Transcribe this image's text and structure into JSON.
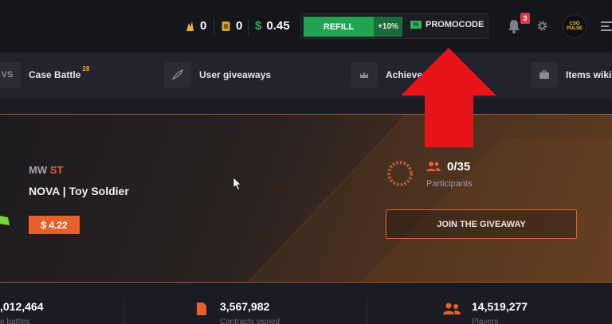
{
  "topbar": {
    "currency_horns": "0",
    "currency_coins": "0",
    "balance_symbol": "$",
    "balance_value": "0.45",
    "refill_label": "REFILL",
    "refill_bonus": "+10%",
    "promo_label": "PROMOCODE",
    "notification_count": "3",
    "avatar_text": "CSG PULSE"
  },
  "nav": {
    "items": [
      {
        "label": "Case Battle",
        "sup": "28",
        "icon": "vs-icon",
        "icon_text": "VS"
      },
      {
        "label": "User giveaways",
        "icon": "feather-icon"
      },
      {
        "label": "Achiever",
        "icon": "crown-icon"
      },
      {
        "label": "Items wiki",
        "icon": "briefcase-icon"
      }
    ]
  },
  "giveaway": {
    "quality_prefix": "MW",
    "quality_st": "ST",
    "item_name": "NOVA | Toy Soldier",
    "price": "$ 4.22",
    "participants_count": "0/35",
    "participants_label": "Participants",
    "join_label": "JOIN THE GIVEAWAY"
  },
  "stats": [
    {
      "value": ",012,464",
      "label": "e battles"
    },
    {
      "value": "3,567,982",
      "label": "Contracts signed"
    },
    {
      "value": "14,519,277",
      "label": "Players"
    }
  ],
  "colors": {
    "accent_orange": "#e8612c",
    "refill_green": "#21a552",
    "arrow_red": "#e8141a",
    "badge_red": "#e0354a"
  }
}
